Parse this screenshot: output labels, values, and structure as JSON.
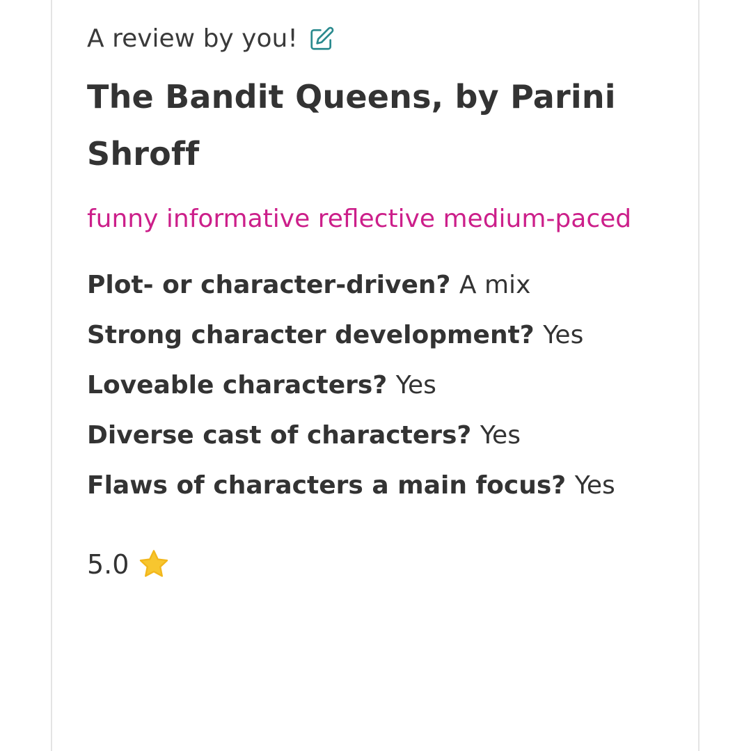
{
  "review": {
    "header": "A review by you!",
    "edit_icon": "edit-pencil-square-icon",
    "title": "The Bandit Queens, by Parini Shroff",
    "moods": "funny informative reflective medium-paced",
    "questions": [
      {
        "q": "Plot- or character-driven?",
        "a": "A mix"
      },
      {
        "q": "Strong character development?",
        "a": "Yes"
      },
      {
        "q": "Loveable characters?",
        "a": "Yes"
      },
      {
        "q": "Diverse cast of characters?",
        "a": "Yes"
      },
      {
        "q": "Flaws of characters a main focus?",
        "a": "Yes"
      }
    ],
    "rating": "5.0",
    "rating_icon": "star-icon"
  },
  "colors": {
    "mood_text": "#cc1f8a",
    "edit_icon": "#2a8a8e",
    "star": "#f7c62f"
  }
}
